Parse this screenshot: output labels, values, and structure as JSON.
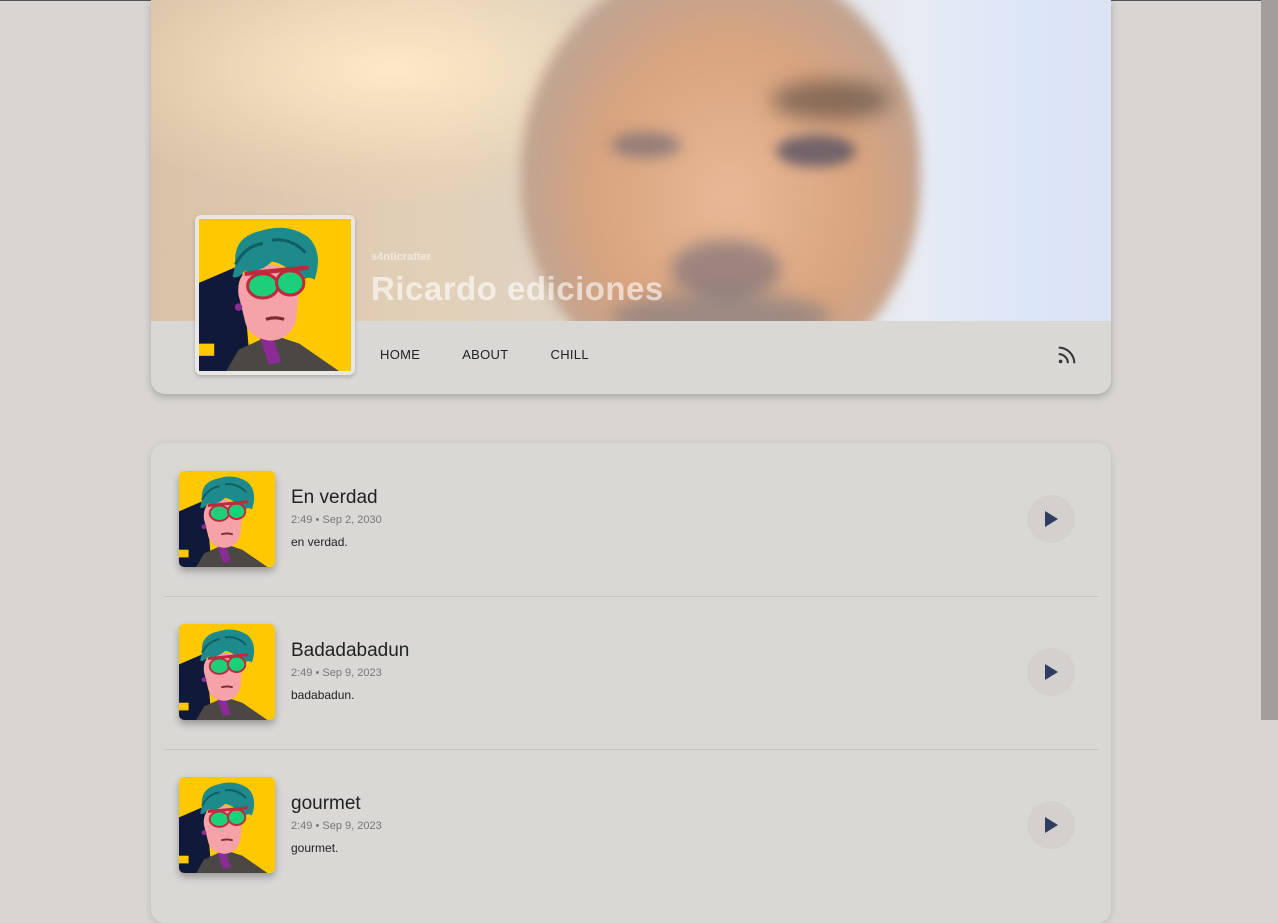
{
  "profile": {
    "username": "s4nticrafter",
    "name": "Ricardo ediciones"
  },
  "nav": {
    "items": [
      "HOME",
      "ABOUT",
      "CHILL"
    ]
  },
  "icons": {
    "feed": "rss-icon",
    "play": "play-icon"
  },
  "colors": {
    "avatar_bg": "#ffc800",
    "play_icon": "#2f3d5e"
  },
  "tracks": [
    {
      "title": "En verdad",
      "meta": "2:49 • Sep 2, 2030",
      "description": "en verdad."
    },
    {
      "title": "Badadabadun",
      "meta": "2:49 • Sep 9, 2023",
      "description": "badabadun."
    },
    {
      "title": "gourmet",
      "meta": "2:49 • Sep 9, 2023",
      "description": "gourmet."
    }
  ]
}
